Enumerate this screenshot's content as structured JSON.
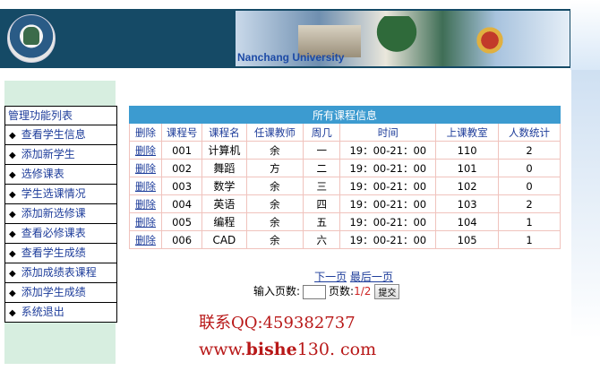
{
  "header": {
    "banner_text": "Nanchang University"
  },
  "sidebar": {
    "title": "管理功能列表",
    "items": [
      {
        "label": "查看学生信息"
      },
      {
        "label": "添加新学生"
      },
      {
        "label": "选修课表"
      },
      {
        "label": "学生选课情况"
      },
      {
        "label": "添加新选修课"
      },
      {
        "label": "查看必修课表"
      },
      {
        "label": "查看学生成绩"
      },
      {
        "label": "添加成绩表课程"
      },
      {
        "label": "添加学生成绩"
      },
      {
        "label": "系统退出"
      }
    ]
  },
  "table": {
    "title": "所有课程信息",
    "columns": [
      "删除",
      "课程号",
      "课程名",
      "任课教师",
      "周几",
      "时间",
      "上课教室",
      "人数统计"
    ],
    "rows": [
      {
        "action": "删除",
        "id": "001",
        "name": "计算机",
        "teacher": "余",
        "day": "一",
        "time": "19：00-21：00",
        "room": "110",
        "count": "2"
      },
      {
        "action": "删除",
        "id": "002",
        "name": "舞蹈",
        "teacher": "方",
        "day": "二",
        "time": "19：00-21：00",
        "room": "101",
        "count": "0"
      },
      {
        "action": "删除",
        "id": "003",
        "name": "数学",
        "teacher": "余",
        "day": "三",
        "time": "19：00-21：00",
        "room": "102",
        "count": "0"
      },
      {
        "action": "删除",
        "id": "004",
        "name": "英语",
        "teacher": "余",
        "day": "四",
        "time": "19：00-21：00",
        "room": "103",
        "count": "2"
      },
      {
        "action": "删除",
        "id": "005",
        "name": "编程",
        "teacher": "余",
        "day": "五",
        "time": "19：00-21：00",
        "room": "104",
        "count": "1"
      },
      {
        "action": "删除",
        "id": "006",
        "name": "CAD",
        "teacher": "余",
        "day": "六",
        "time": "19：00-21：00",
        "room": "105",
        "count": "1"
      }
    ]
  },
  "pager": {
    "next_label": "下一页",
    "last_label": "最后一页",
    "input_label": "输入页数:",
    "page_label": "页数:",
    "page_value": "1/2",
    "submit_label": "提交"
  },
  "watermark": {
    "qq": "联系QQ:459382737",
    "site_prefix": "www.",
    "site_bold": "bishe",
    "site_suffix": "130. com"
  },
  "colors": {
    "header_bg": "#154a66",
    "table_title_bg": "#3c9bd0",
    "sidebar_bg": "#d7eee0",
    "link": "#1d3c9a",
    "watermark": "#b81818"
  }
}
